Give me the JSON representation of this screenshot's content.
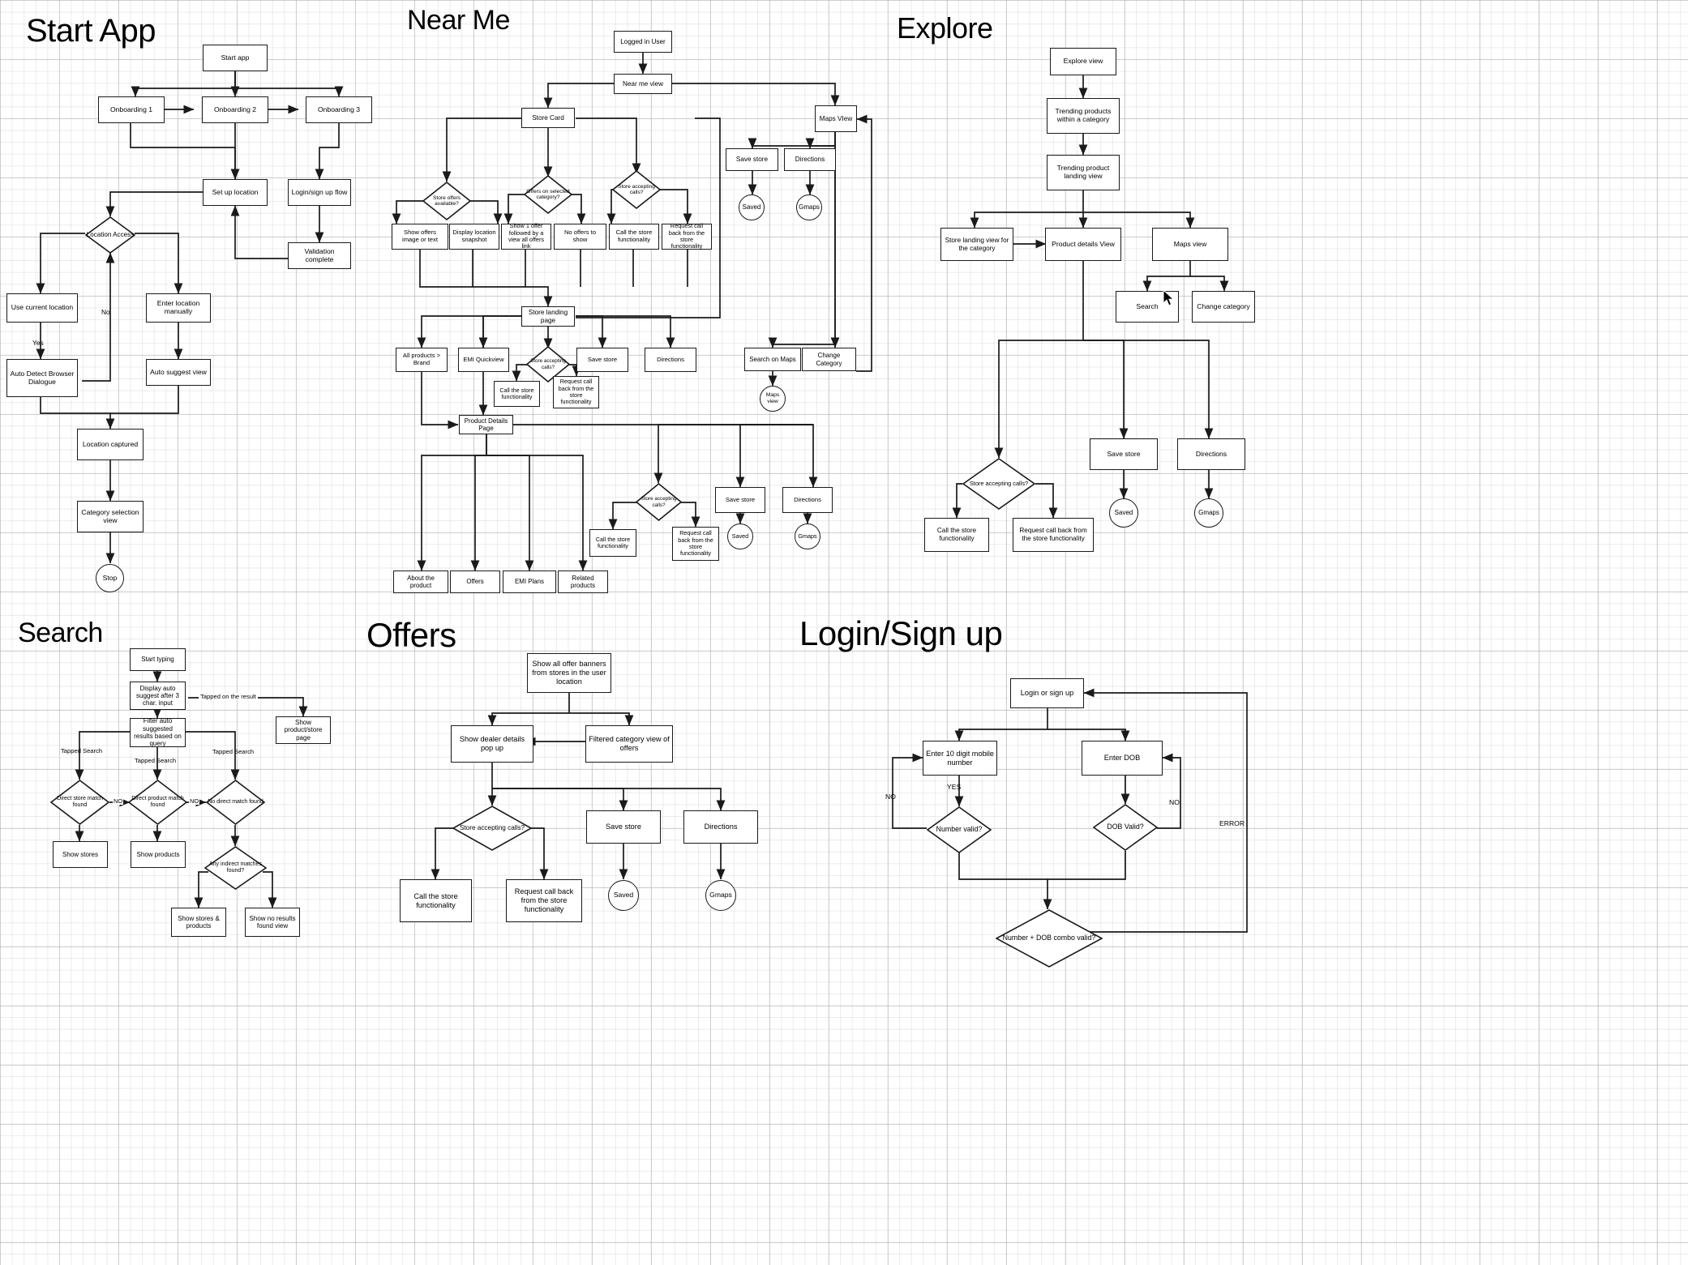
{
  "document": {
    "type": "user-flow-flowchart",
    "background": "graph-paper-grid",
    "line_color": "#1a1a1a",
    "node_fill": "#ffffff"
  },
  "sections": [
    {
      "id": "start_app",
      "title": "Start App"
    },
    {
      "id": "near_me",
      "title": "Near Me"
    },
    {
      "id": "explore",
      "title": "Explore"
    },
    {
      "id": "search",
      "title": "Search"
    },
    {
      "id": "offers",
      "title": "Offers"
    },
    {
      "id": "login",
      "title": "Login/Sign up"
    }
  ],
  "start_app": {
    "nodes": [
      {
        "id": "start_app",
        "label": "Start app"
      },
      {
        "id": "onboarding1",
        "label": "Onboarding 1"
      },
      {
        "id": "onboarding2",
        "label": "Onboarding 2"
      },
      {
        "id": "onboarding3",
        "label": "Onboarding 3"
      },
      {
        "id": "set_up_location",
        "label": "Set up location"
      },
      {
        "id": "login_signup",
        "label": "Login/sign up flow"
      },
      {
        "id": "validation",
        "label": "Validation complete"
      },
      {
        "id": "location_access",
        "label": "Location Access",
        "shape": "diamond"
      },
      {
        "id": "use_current",
        "label": "Use current location"
      },
      {
        "id": "enter_manual",
        "label": "Enter location manually"
      },
      {
        "id": "auto_detect",
        "label": "Auto Detect Browser Dialogue"
      },
      {
        "id": "auto_suggest",
        "label": "Auto suggest view"
      },
      {
        "id": "location_captured",
        "label": "Location captured"
      },
      {
        "id": "category_sel",
        "label": "Category selection view"
      },
      {
        "id": "stop",
        "label": "Stop",
        "shape": "circle"
      }
    ],
    "edge_labels": [
      {
        "id": "no",
        "label": "No"
      },
      {
        "id": "yes",
        "label": "Yes"
      }
    ]
  },
  "near_me": {
    "nodes": [
      {
        "id": "logged_in",
        "label": "Logged in User"
      },
      {
        "id": "near_me_view",
        "label": "Near me view"
      },
      {
        "id": "store_card",
        "label": "Store Card"
      },
      {
        "id": "maps_view",
        "label": "Maps VIew"
      },
      {
        "id": "save_store_top",
        "label": "Save store"
      },
      {
        "id": "directions_top",
        "label": "Directions"
      },
      {
        "id": "saved_top",
        "label": "Saved",
        "shape": "circle"
      },
      {
        "id": "gmaps_top",
        "label": "Gmaps",
        "shape": "circle"
      },
      {
        "id": "store_offers_q",
        "label": "Store offers available?",
        "shape": "diamond"
      },
      {
        "id": "offers_cat_q",
        "label": "Offers on selected category?",
        "shape": "diamond"
      },
      {
        "id": "store_calls_q1",
        "label": "Store accepting calls?",
        "shape": "diamond"
      },
      {
        "id": "show_offers_img",
        "label": "Show offers image or text"
      },
      {
        "id": "display_loc_snap",
        "label": "Display location snapshot"
      },
      {
        "id": "show_1_offer",
        "label": "Show 1 offer followed by a view all offers link"
      },
      {
        "id": "no_offers",
        "label": "No offers to show"
      },
      {
        "id": "call_store_1",
        "label": "Call the store functionality"
      },
      {
        "id": "request_call_1",
        "label": "Request call back from the store functionality"
      },
      {
        "id": "store_landing",
        "label": "Store landing page"
      },
      {
        "id": "all_products",
        "label": "All products > Brand"
      },
      {
        "id": "emi_quickview",
        "label": "EMI Quickview"
      },
      {
        "id": "store_calls_q2",
        "label": "Store accepting calls?",
        "shape": "diamond"
      },
      {
        "id": "save_store_mid",
        "label": "Save store"
      },
      {
        "id": "directions_mid",
        "label": "Directions"
      },
      {
        "id": "call_store_2",
        "label": "Call the store functionality"
      },
      {
        "id": "request_call_2",
        "label": "Request call back from the store functionality"
      },
      {
        "id": "search_on_maps",
        "label": "Search on Maps"
      },
      {
        "id": "change_category",
        "label": "Change Category"
      },
      {
        "id": "maps_view_small",
        "label": "Maps view",
        "shape": "circle"
      },
      {
        "id": "product_details",
        "label": "Product Details Page"
      },
      {
        "id": "store_calls_q3",
        "label": "Store accepting calls?",
        "shape": "diamond"
      },
      {
        "id": "save_store_bot",
        "label": "Save store"
      },
      {
        "id": "directions_bot",
        "label": "Directions"
      },
      {
        "id": "saved_bot",
        "label": "Saved",
        "shape": "circle"
      },
      {
        "id": "gmaps_bot",
        "label": "Gmaps",
        "shape": "circle"
      },
      {
        "id": "call_store_3",
        "label": "Call the store functionality"
      },
      {
        "id": "request_call_3",
        "label": "Request call back from the store functionality"
      },
      {
        "id": "about_product",
        "label": "About the product"
      },
      {
        "id": "offers_tab",
        "label": "Offers"
      },
      {
        "id": "emi_plans",
        "label": "EMI Plans"
      },
      {
        "id": "related_products",
        "label": "Related products"
      }
    ]
  },
  "explore": {
    "nodes": [
      {
        "id": "explore_view",
        "label": "Explore view"
      },
      {
        "id": "trending_cat",
        "label": "Trending products within a category"
      },
      {
        "id": "trending_landing",
        "label": "Trending product landing view"
      },
      {
        "id": "store_landing_cat",
        "label": "Store landing view for the category"
      },
      {
        "id": "product_details_v",
        "label": "Product details View"
      },
      {
        "id": "maps_view_ex",
        "label": "Maps view"
      },
      {
        "id": "search_ex",
        "label": "Search"
      },
      {
        "id": "change_category_ex",
        "label": "Change category"
      },
      {
        "id": "store_calls_ex",
        "label": "Store accepting calls?",
        "shape": "diamond"
      },
      {
        "id": "save_store_ex",
        "label": "Save store"
      },
      {
        "id": "directions_ex",
        "label": "Directions"
      },
      {
        "id": "saved_ex",
        "label": "Saved",
        "shape": "circle"
      },
      {
        "id": "gmaps_ex",
        "label": "Gmaps",
        "shape": "circle"
      },
      {
        "id": "call_store_ex",
        "label": "Call the store functionality"
      },
      {
        "id": "request_call_ex",
        "label": "Request call back from the store functionality"
      }
    ]
  },
  "search": {
    "nodes": [
      {
        "id": "start_typing",
        "label": "Start typing"
      },
      {
        "id": "display_auto",
        "label": "Display auto suggest after 3 char. input"
      },
      {
        "id": "filter_auto",
        "label": "Filter auto suggested results based on query"
      },
      {
        "id": "show_prod_store",
        "label": "Show product/store page"
      },
      {
        "id": "direct_store_q",
        "label": "Direct store match found",
        "shape": "diamond"
      },
      {
        "id": "direct_prod_q",
        "label": "Direct product match found",
        "shape": "diamond"
      },
      {
        "id": "no_direct_q",
        "label": "No direct match found",
        "shape": "diamond"
      },
      {
        "id": "show_stores",
        "label": "Show stores"
      },
      {
        "id": "show_products",
        "label": "Show products"
      },
      {
        "id": "any_indirect_q",
        "label": "Any indirect matches found?",
        "shape": "diamond"
      },
      {
        "id": "show_stores_prod",
        "label": "Show stores & products"
      },
      {
        "id": "show_no_results",
        "label": "Show no results found view"
      }
    ],
    "edge_labels": [
      {
        "id": "tapped_result",
        "label": "Tapped on the result"
      },
      {
        "id": "tapped_search_1",
        "label": "Tapped Search"
      },
      {
        "id": "tapped_search_2",
        "label": "Tapped Search"
      },
      {
        "id": "tapped_search_3",
        "label": "Tapped Search"
      },
      {
        "id": "no_1",
        "label": "NO"
      },
      {
        "id": "no_2",
        "label": "NO"
      }
    ]
  },
  "offers": {
    "nodes": [
      {
        "id": "show_all_banners",
        "label": "Show all offer banners from stores in the user location"
      },
      {
        "id": "dealer_popup",
        "label": "Show dealer details pop up"
      },
      {
        "id": "filtered_cat",
        "label": "Filtered category view of offers"
      },
      {
        "id": "store_calls_off",
        "label": "Store accepting calls?",
        "shape": "diamond"
      },
      {
        "id": "save_store_off",
        "label": "Save store"
      },
      {
        "id": "directions_off",
        "label": "Directions"
      },
      {
        "id": "call_store_off",
        "label": "Call the store functionality"
      },
      {
        "id": "request_call_off",
        "label": "Request call back from the store functionality"
      },
      {
        "id": "saved_off",
        "label": "Saved",
        "shape": "circle"
      },
      {
        "id": "gmaps_off",
        "label": "Gmaps",
        "shape": "circle"
      }
    ]
  },
  "login": {
    "nodes": [
      {
        "id": "login_or_signup",
        "label": "Login or sign up"
      },
      {
        "id": "enter_mobile",
        "label": "Enter 10 digit mobile number"
      },
      {
        "id": "enter_dob",
        "label": "Enter DOB"
      },
      {
        "id": "number_valid_q",
        "label": "Number valid?",
        "shape": "diamond"
      },
      {
        "id": "dob_valid_q",
        "label": "DOB Valid?",
        "shape": "diamond"
      },
      {
        "id": "combo_valid_q",
        "label": "Number + DOB combo valid?",
        "shape": "diamond"
      }
    ],
    "edge_labels": [
      {
        "id": "no_left",
        "label": "NO"
      },
      {
        "id": "yes_mid",
        "label": "YES"
      },
      {
        "id": "no_right",
        "label": "NO"
      },
      {
        "id": "error",
        "label": "ERROR"
      }
    ]
  }
}
